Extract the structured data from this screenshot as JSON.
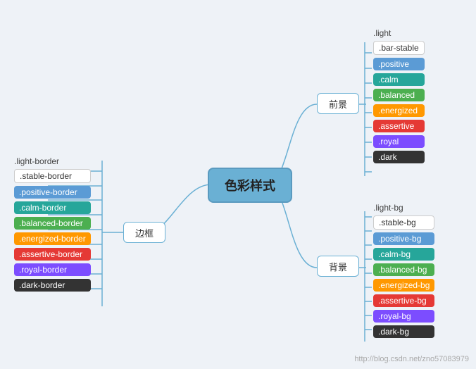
{
  "center": {
    "label": "色彩样式"
  },
  "midNodes": {
    "foreground": {
      "label": "前景"
    },
    "border": {
      "label": "边框"
    },
    "background": {
      "label": "背景"
    }
  },
  "foreground": {
    "topLabel": ".light",
    "items": [
      {
        "label": ".bar-stable",
        "class": "tag-stable"
      },
      {
        "label": ".positive",
        "class": "tag-blue"
      },
      {
        "label": ".calm",
        "class": "tag-teal"
      },
      {
        "label": ".balanced",
        "class": "tag-green"
      },
      {
        "label": ".energized",
        "class": "tag-orange"
      },
      {
        "label": ".assertive",
        "class": "tag-red"
      },
      {
        "label": ".royal",
        "class": "tag-purple"
      },
      {
        "label": ".dark",
        "class": "tag-dark"
      }
    ]
  },
  "border": {
    "topLabel": ".light-border",
    "items": [
      {
        "label": ".stable-border",
        "class": "tag-stable"
      },
      {
        "label": ".positive-border",
        "class": "tag-blue"
      },
      {
        "label": ".calm-border",
        "class": "tag-teal"
      },
      {
        "label": ".balanced-border",
        "class": "tag-green"
      },
      {
        "label": ".energized-border",
        "class": "tag-orange"
      },
      {
        "label": ".assertive-border",
        "class": "tag-red"
      },
      {
        "label": ".royal-border",
        "class": "tag-purple"
      },
      {
        "label": ".dark-border",
        "class": "tag-dark"
      }
    ]
  },
  "background": {
    "topLabel": ".light-bg",
    "items": [
      {
        "label": ".stable-bg",
        "class": "tag-stable"
      },
      {
        "label": ".positive-bg",
        "class": "tag-blue"
      },
      {
        "label": ".calm-bg",
        "class": "tag-teal"
      },
      {
        "label": ".balanced-bg",
        "class": "tag-green"
      },
      {
        "label": ".energized-bg",
        "class": "tag-orange"
      },
      {
        "label": ".assertive-bg",
        "class": "tag-red"
      },
      {
        "label": ".royal-bg",
        "class": "tag-purple"
      },
      {
        "label": ".dark-bg",
        "class": "tag-dark"
      }
    ]
  },
  "watermark": "http://blog.csdn.net/zno57083979"
}
